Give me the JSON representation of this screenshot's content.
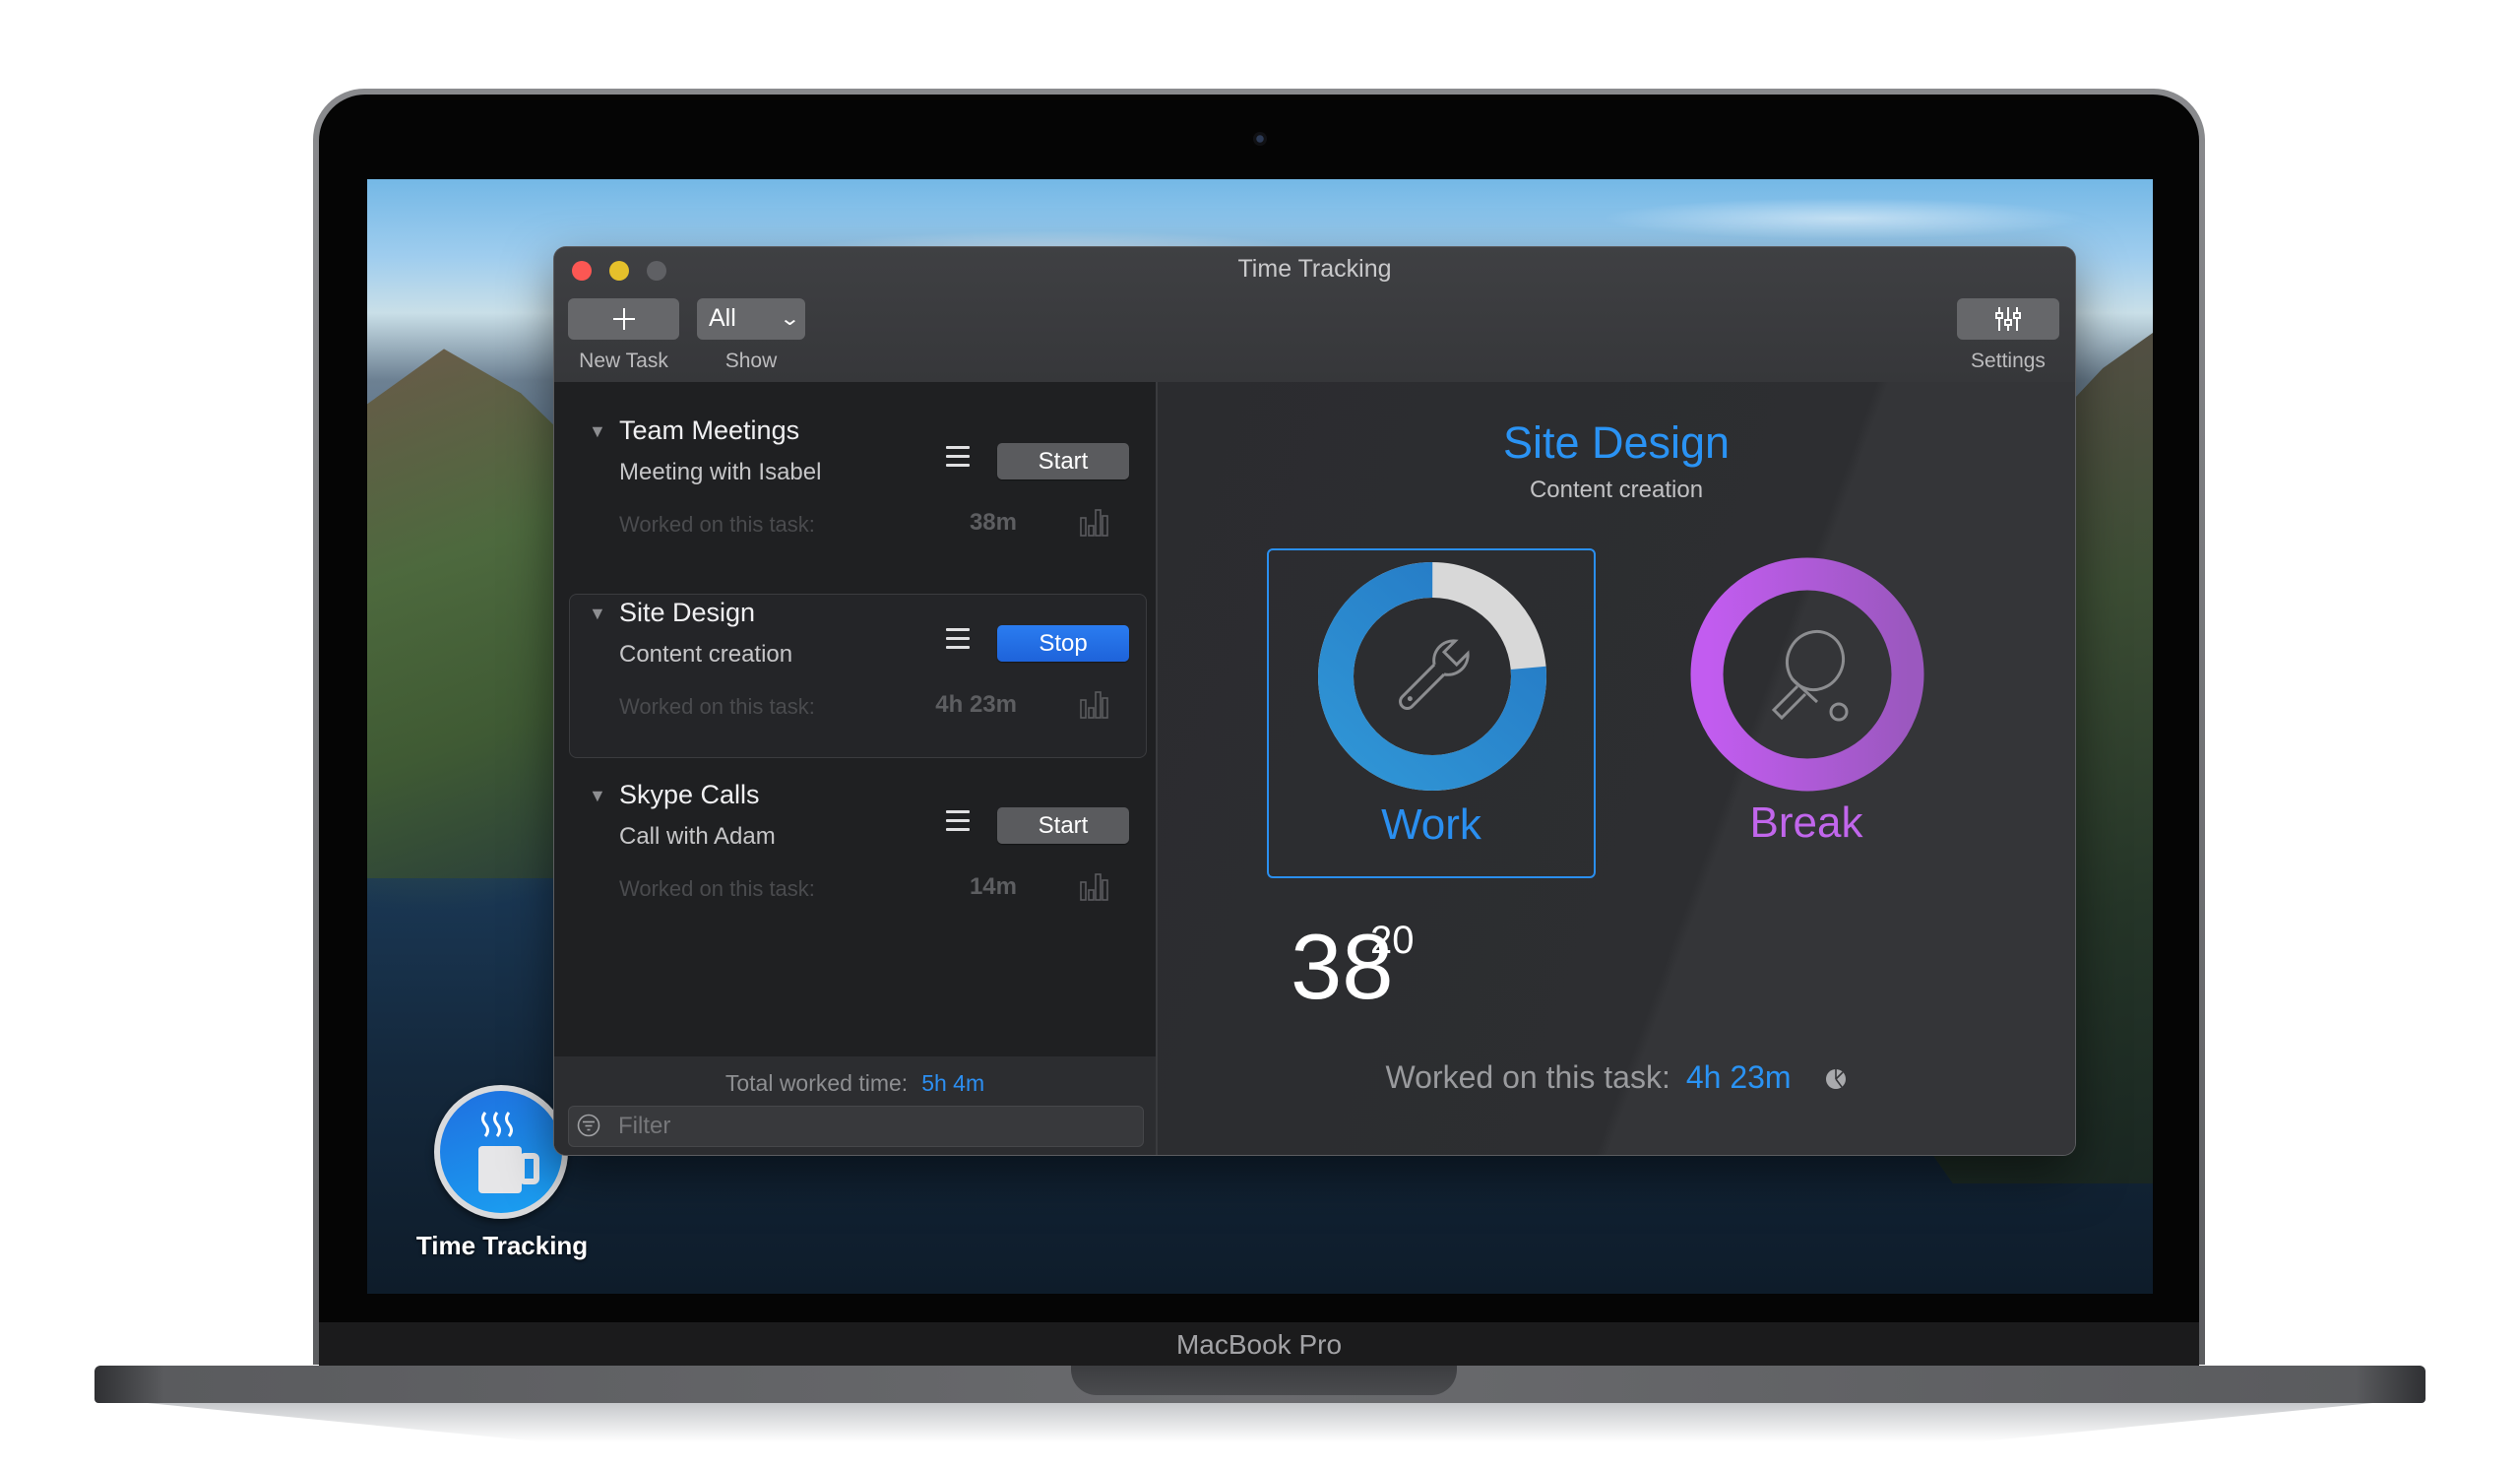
{
  "device": {
    "chin_label": "MacBook Pro"
  },
  "desktop": {
    "dock_icon": {
      "icon": "coffee-mug-icon",
      "label": "Time Tracking"
    }
  },
  "window": {
    "title": "Time Tracking",
    "traffic_lights": [
      "close",
      "minimize",
      "zoom"
    ],
    "toolbar": {
      "new_task": {
        "icon": "plus-icon",
        "label": "New Task"
      },
      "show": {
        "selected": "All",
        "label": "Show"
      },
      "settings": {
        "icon": "sliders-icon",
        "label": "Settings"
      }
    }
  },
  "sidebar": {
    "tasks": [
      {
        "title": "Team Meetings",
        "subtitle": "Meeting with Isabel",
        "worked_label": "Worked on this task:",
        "worked_time": "38m",
        "button": "Start",
        "active": false
      },
      {
        "title": "Site Design",
        "subtitle": "Content creation",
        "worked_label": "Worked on this task:",
        "worked_time": "4h 23m",
        "button": "Stop",
        "active": true
      },
      {
        "title": "Skype Calls",
        "subtitle": "Call with Adam",
        "worked_label": "Worked on this task:",
        "worked_time": "14m",
        "button": "Start",
        "active": false
      }
    ],
    "footer": {
      "total_label": "Total worked time:",
      "total_value": "5h 4m",
      "filter_placeholder": "Filter"
    }
  },
  "main": {
    "task_title": "Site Design",
    "task_subtitle": "Content creation",
    "modes": {
      "work": {
        "label": "Work",
        "icon": "wrench-icon",
        "selected": true,
        "remaining_fraction": 0.764,
        "color": "#2a8ff0"
      },
      "break": {
        "label": "Break",
        "icon": "ping-pong-icon",
        "selected": false,
        "remaining_fraction": 1.0,
        "color": "#c166ec"
      }
    },
    "timer": {
      "minutes": "38",
      "seconds": "20"
    },
    "worked_label": "Worked on this task:",
    "worked_value": "4h 23m"
  },
  "colors": {
    "accent": "#2a93f4",
    "stop_button": "#1e63da",
    "break": "#c166ec"
  }
}
